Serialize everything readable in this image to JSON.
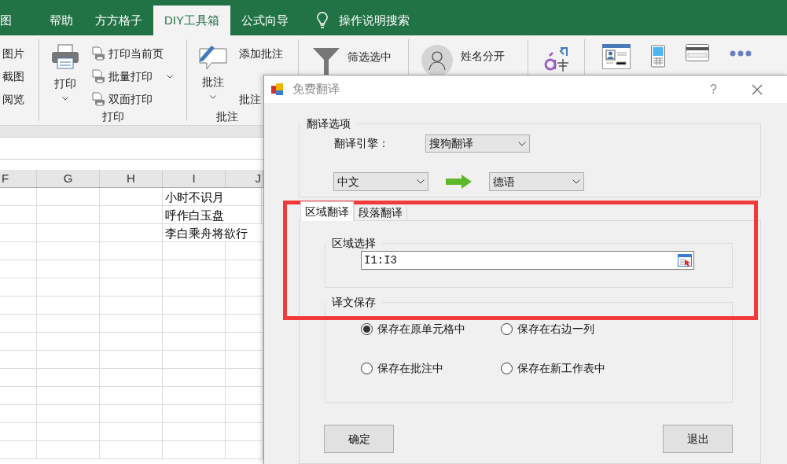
{
  "ribbon_tabs": [
    {
      "label": "图",
      "selected": false
    },
    {
      "label": "帮助",
      "selected": false
    },
    {
      "label": "方方格子",
      "selected": false
    },
    {
      "label": "DIY工具箱",
      "selected": true
    },
    {
      "label": "公式向导",
      "selected": false
    }
  ],
  "search_label": "操作说明搜索",
  "ribbon": {
    "left_items": [
      "图片",
      "截图",
      "阅览"
    ],
    "print_group": {
      "label": "打印",
      "big_button": "打印",
      "items": [
        "打印当前页",
        "批量打印",
        "双面打印"
      ]
    },
    "comment_group": {
      "label": "批注",
      "big_button": "批注",
      "items": [
        "添加批注",
        "批注"
      ]
    },
    "filter_items": [
      "筛选选中"
    ],
    "name_items": [
      "姓名分开"
    ]
  },
  "sheet": {
    "columns": [
      "F",
      "G",
      "H",
      "I",
      "J"
    ],
    "cells_I": [
      "小时不识月",
      "呼作白玉盘",
      "李白乘舟将欲行"
    ]
  },
  "dialog": {
    "title": "免费翻译",
    "help": "?",
    "options_group": "翻译选项",
    "engine_label": "翻译引擎：",
    "engine": "搜狗翻译",
    "source": "中文",
    "target": "德语",
    "tabs": [
      {
        "label": "区域翻译",
        "selected": true
      },
      {
        "label": "段落翻译",
        "selected": false
      }
    ],
    "range_group": "区域选择",
    "range_value": "I1:I3",
    "save_group": "译文保存",
    "save_options": [
      {
        "label": "保存在原单元格中",
        "selected": true
      },
      {
        "label": "保存在右边一列",
        "selected": false
      },
      {
        "label": "保存在批注中",
        "selected": false
      },
      {
        "label": "保存在新工作表中",
        "selected": false
      }
    ],
    "buttons": [
      "确定",
      "退出"
    ]
  }
}
